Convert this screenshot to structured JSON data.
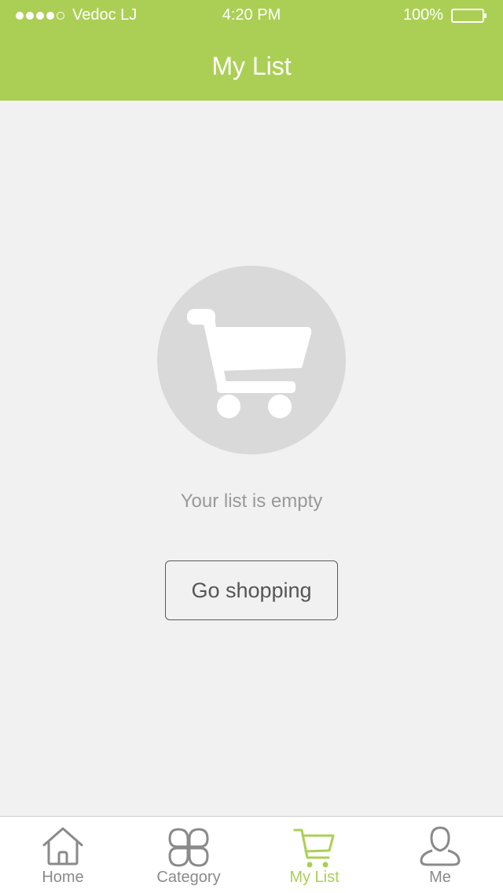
{
  "status_bar": {
    "carrier": "Vedoc LJ",
    "time": "4:20 PM",
    "battery": "100%"
  },
  "header": {
    "title": "My List"
  },
  "empty_state": {
    "message": "Your list is empty",
    "button_label": "Go shopping",
    "icon": "cart-icon"
  },
  "tabbar": {
    "items": [
      {
        "label": "Home",
        "icon": "home-icon",
        "active": false
      },
      {
        "label": "Category",
        "icon": "category-icon",
        "active": false
      },
      {
        "label": "My List",
        "icon": "cart-icon",
        "active": true
      },
      {
        "label": "Me",
        "icon": "user-icon",
        "active": false
      }
    ]
  },
  "colors": {
    "accent": "#abcf55",
    "background": "#f1f1f1",
    "inactive": "#8a8a8a"
  }
}
